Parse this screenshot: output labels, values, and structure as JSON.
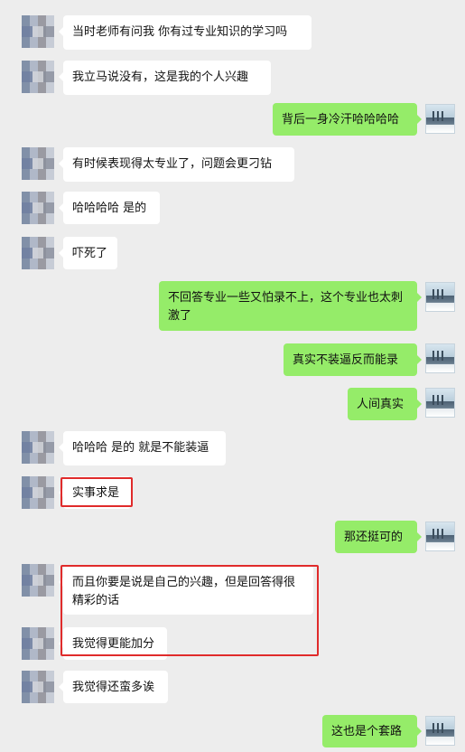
{
  "messages": [
    {
      "side": "in",
      "text": "当时老师有问我 你有过专业知识的学习吗"
    },
    {
      "side": "in",
      "text": "我立马说没有，这是我的个人兴趣"
    },
    {
      "side": "out",
      "text": "背后一身冷汗哈哈哈哈"
    },
    {
      "side": "in",
      "text": "有时候表现得太专业了，问题会更刁钻"
    },
    {
      "side": "in",
      "text": "哈哈哈哈 是的"
    },
    {
      "side": "in",
      "text": "吓死了"
    },
    {
      "side": "out",
      "text": "不回答专业一些又怕录不上，这个专业也太刺激了"
    },
    {
      "side": "out",
      "text": "真实不装逼反而能录"
    },
    {
      "side": "out",
      "text": "人间真实"
    },
    {
      "side": "in",
      "text": "哈哈哈 是的 就是不能装逼"
    },
    {
      "side": "in",
      "text": "实事求是"
    },
    {
      "side": "out",
      "text": "那还挺可的"
    },
    {
      "side": "in",
      "text": "而且你要是说是自己的兴趣，但是回答得很精彩的话"
    },
    {
      "side": "in",
      "text": "我觉得更能加分"
    },
    {
      "side": "in",
      "text": "我觉得还蛮多诶"
    },
    {
      "side": "out",
      "text": "这也是个套路"
    }
  ],
  "colors": {
    "background": "#ededed",
    "incoming_bubble": "#ffffff",
    "outgoing_bubble": "#95ec69",
    "highlight_box": "#e02b2b"
  }
}
